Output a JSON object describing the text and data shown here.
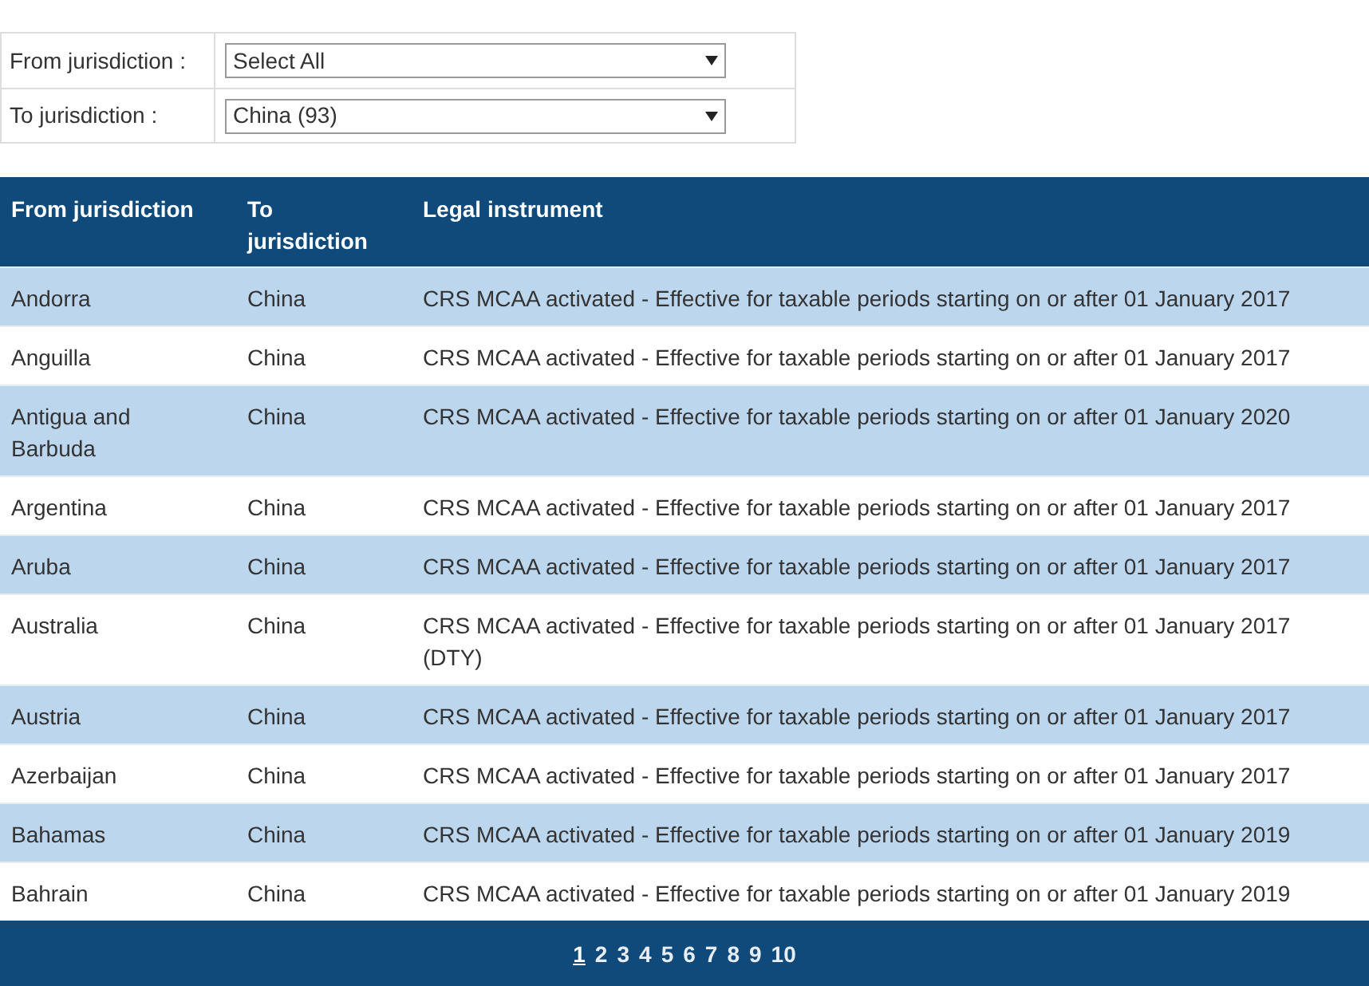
{
  "filters": [
    {
      "label": "From jurisdiction :",
      "value": "Select All"
    },
    {
      "label": "To jurisdiction :",
      "value": "China (93)"
    }
  ],
  "table": {
    "columns": [
      "From jurisdiction",
      "To jurisdiction",
      "Legal instrument"
    ],
    "rows": [
      {
        "from": "Andorra",
        "to": "China",
        "instrument": "CRS MCAA activated - Effective for taxable periods starting on or after 01 January 2017"
      },
      {
        "from": "Anguilla",
        "to": "China",
        "instrument": "CRS MCAA activated - Effective for taxable periods starting on or after 01 January 2017"
      },
      {
        "from": "Antigua and Barbuda",
        "to": "China",
        "instrument": "CRS MCAA activated - Effective for taxable periods starting on or after 01 January 2020"
      },
      {
        "from": "Argentina",
        "to": "China",
        "instrument": "CRS MCAA activated - Effective for taxable periods starting on or after 01 January 2017"
      },
      {
        "from": "Aruba",
        "to": "China",
        "instrument": "CRS MCAA activated - Effective for taxable periods starting on or after 01 January 2017"
      },
      {
        "from": "Australia",
        "to": "China",
        "instrument": "CRS MCAA activated - Effective for taxable periods starting on or after 01 January 2017 (DTY)"
      },
      {
        "from": "Austria",
        "to": "China",
        "instrument": "CRS MCAA activated - Effective for taxable periods starting on or after 01 January 2017"
      },
      {
        "from": "Azerbaijan",
        "to": "China",
        "instrument": "CRS MCAA activated - Effective for taxable periods starting on or after 01 January 2017"
      },
      {
        "from": "Bahamas",
        "to": "China",
        "instrument": "CRS MCAA activated - Effective for taxable periods starting on or after 01 January 2019"
      },
      {
        "from": "Bahrain",
        "to": "China",
        "instrument": "CRS MCAA activated - Effective for taxable periods starting on or after 01 January 2019"
      }
    ]
  },
  "pagination": [
    {
      "label": "1",
      "selected": true
    },
    {
      "label": "2",
      "selected": false
    },
    {
      "label": "3",
      "selected": false
    },
    {
      "label": "4",
      "selected": false
    },
    {
      "label": "5",
      "selected": false
    },
    {
      "label": "6",
      "selected": false
    },
    {
      "label": "7",
      "selected": false
    },
    {
      "label": "8",
      "selected": false
    },
    {
      "label": "9",
      "selected": false
    },
    {
      "label": "10",
      "selected": false
    }
  ]
}
